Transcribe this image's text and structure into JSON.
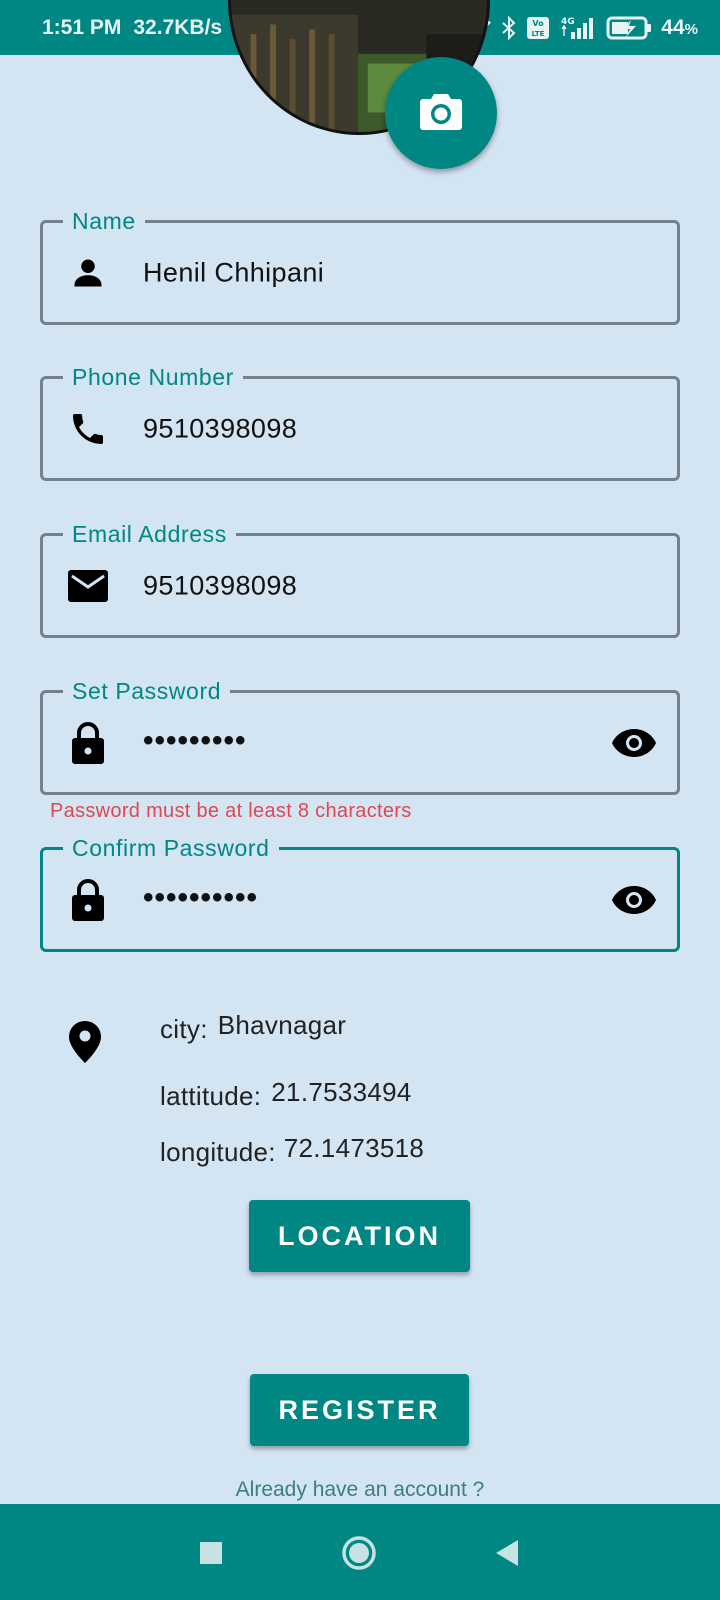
{
  "status_bar": {
    "time": "1:51 PM",
    "speed": "32.7KB/s",
    "dots": "··",
    "battery": "44",
    "battery_unit": "%"
  },
  "form": {
    "name": {
      "label": "Name",
      "value": "Henil Chhipani",
      "icon": "person-icon"
    },
    "phone": {
      "label": "Phone Number",
      "value": "9510398098",
      "icon": "phone-icon"
    },
    "email": {
      "label": "Email Address",
      "value": "9510398098",
      "icon": "mail-icon"
    },
    "password": {
      "label": "Set Password",
      "value": "•••••••••",
      "icon": "lock-icon",
      "error": "Password must be at least 8 characters"
    },
    "confirm": {
      "label": "Confirm Password",
      "value": "••••••••••",
      "icon": "lock-icon"
    }
  },
  "location": {
    "city_label": "city:",
    "city": "Bhavnagar",
    "lat_label": "lattitude:",
    "lat": "21.7533494",
    "lon_label": "longitude:",
    "lon": "72.1473518",
    "button": "LOCATION"
  },
  "register_button": "REGISTER",
  "login_link": "Already have an account ?",
  "colors": {
    "primary": "#008683",
    "background": "#d3e4f3",
    "error": "#e0484f",
    "outline": "#74808a"
  }
}
